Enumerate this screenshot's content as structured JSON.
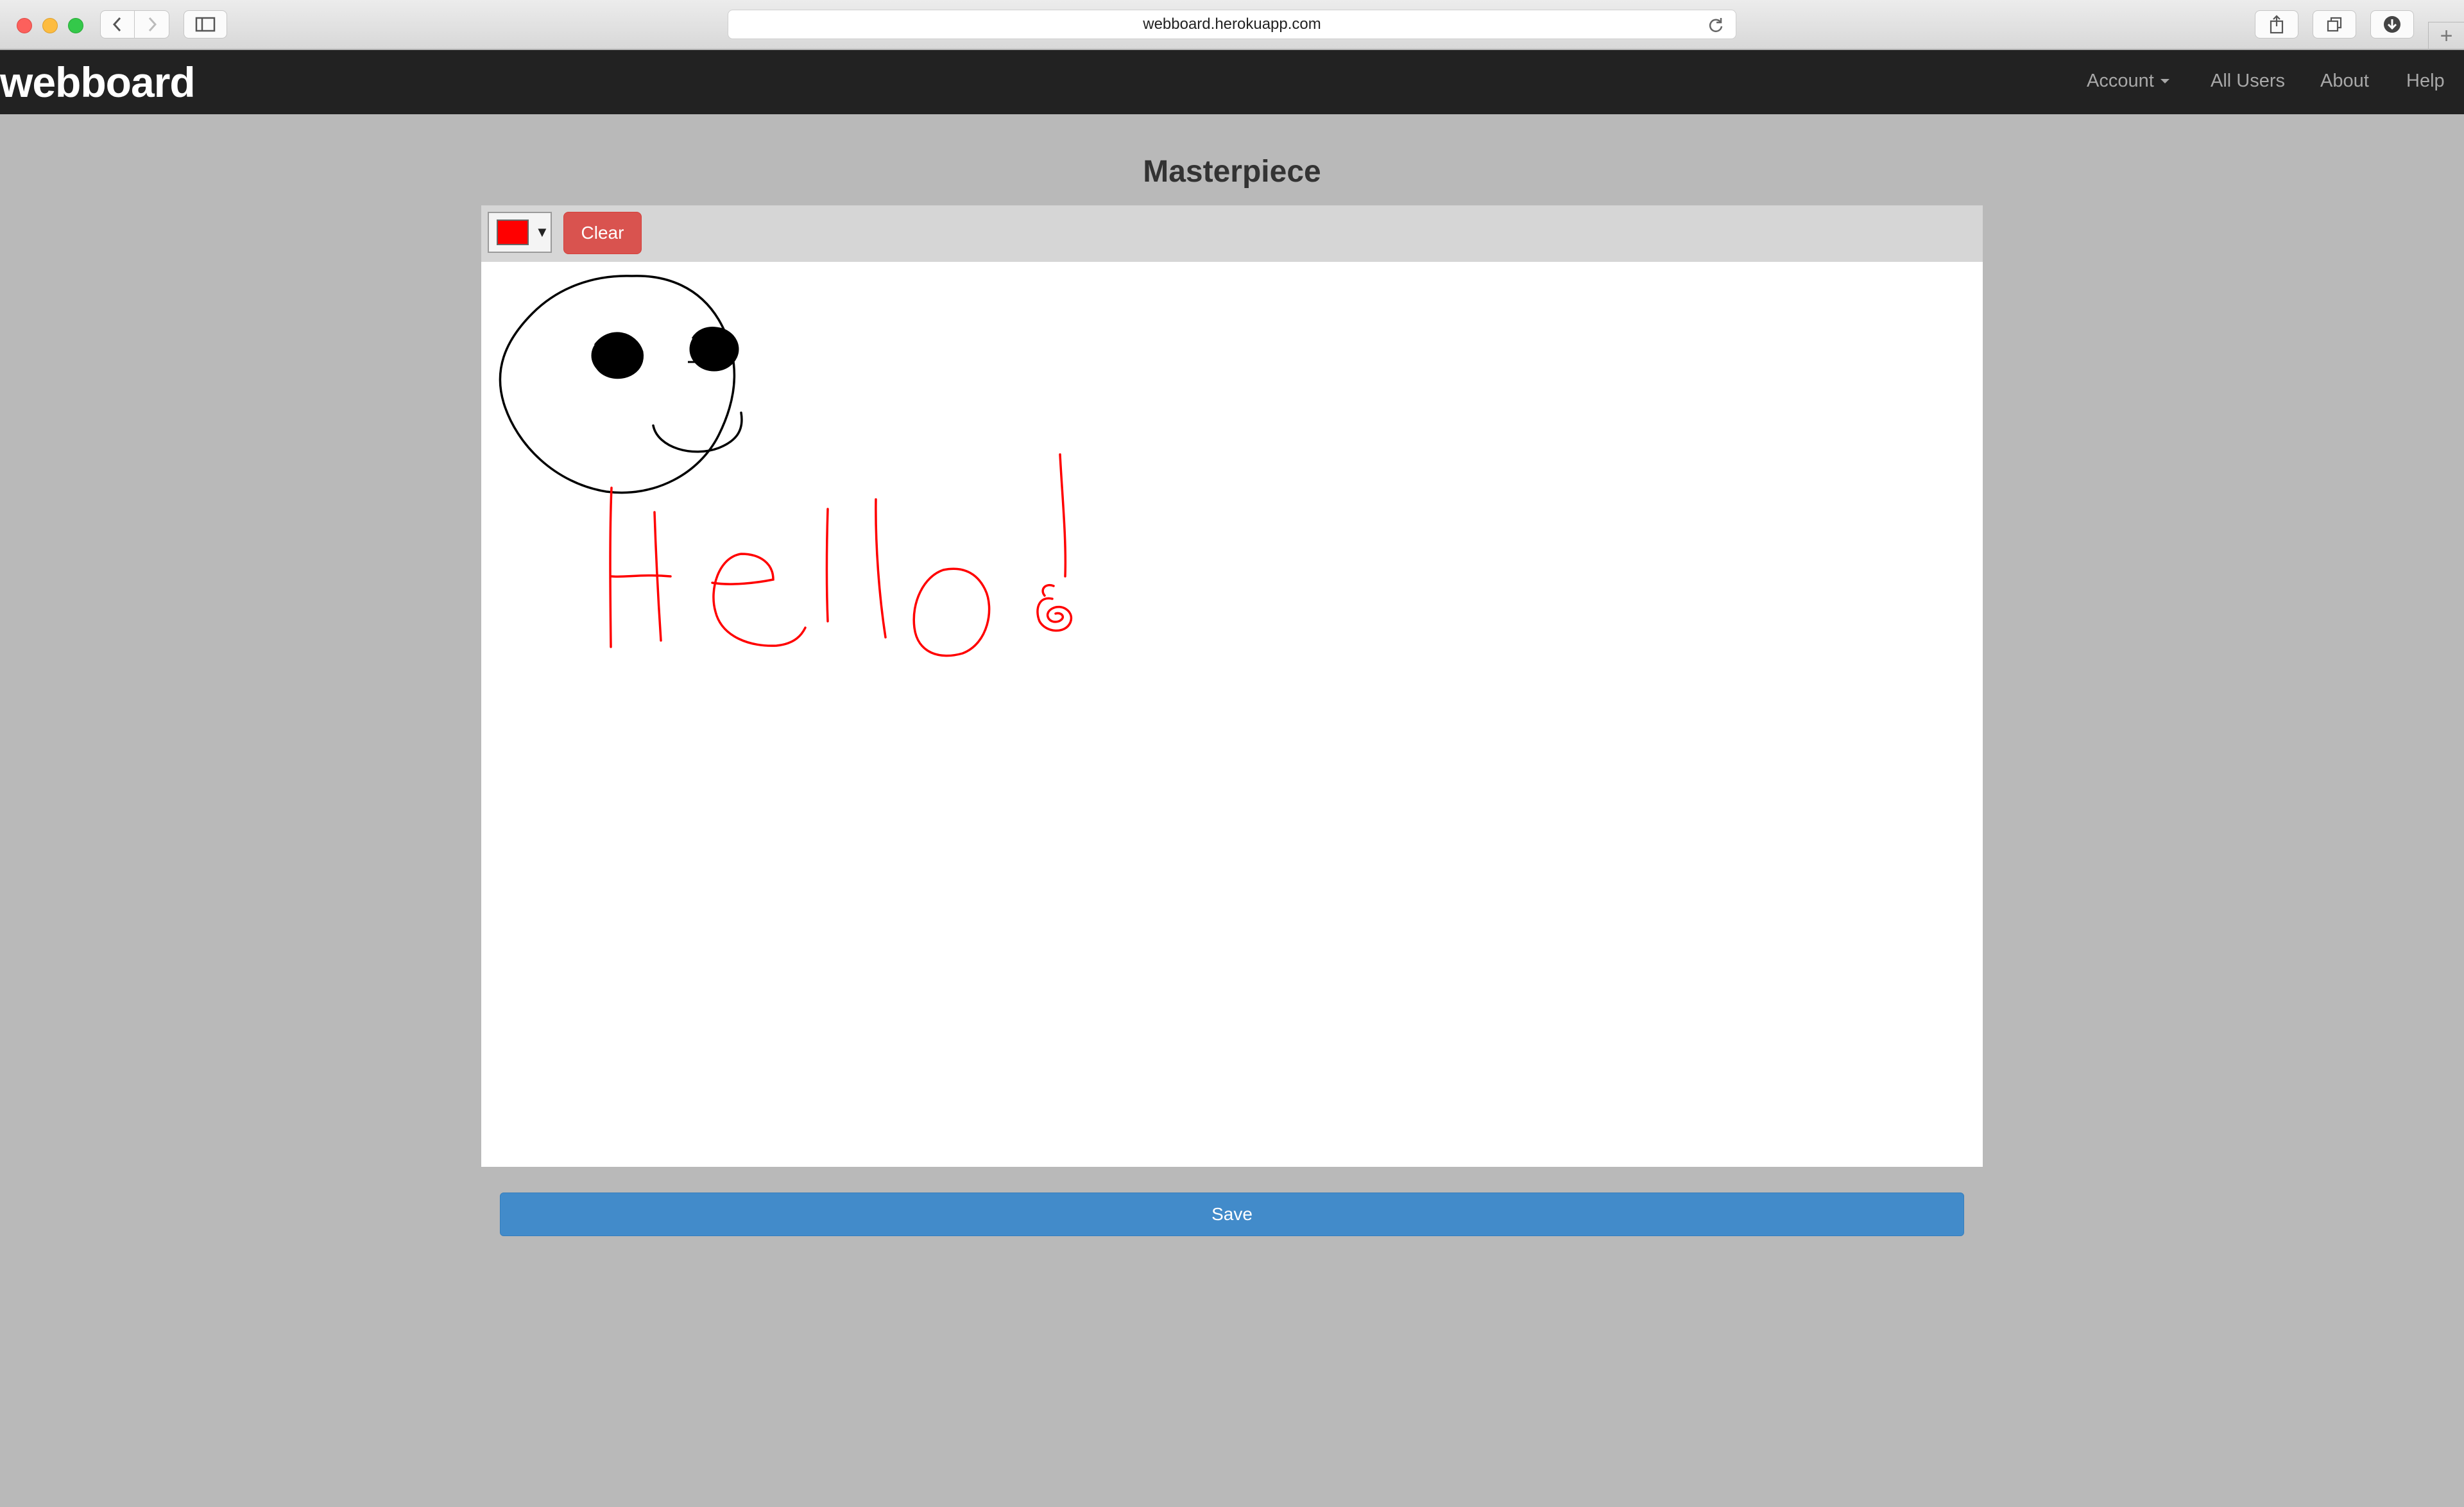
{
  "browser": {
    "url": "webboard.herokuapp.com",
    "icons": {
      "back": "chevron-left-icon",
      "forward": "chevron-right-icon",
      "sidebar": "sidebar-icon",
      "reload": "reload-icon",
      "share": "share-icon",
      "tabs": "tabs-icon",
      "download": "download-icon",
      "new_tab": "plus-icon"
    }
  },
  "navbar": {
    "brand": "webboard",
    "items": [
      {
        "label": "Account",
        "has_dropdown": true
      },
      {
        "label": "All Users"
      },
      {
        "label": "About"
      },
      {
        "label": "Help"
      }
    ]
  },
  "drawing": {
    "title": "Masterpiece",
    "color_picker": {
      "selected_color": "#ff0000"
    },
    "clear_label": "Clear",
    "save_label": "Save",
    "stroke_colors": [
      "#000000",
      "#ff0000"
    ]
  },
  "colors": {
    "navbar_bg": "#222222",
    "page_bg": "#b9b9b9",
    "clear_button": "#d9534f",
    "save_button": "#428bca"
  }
}
